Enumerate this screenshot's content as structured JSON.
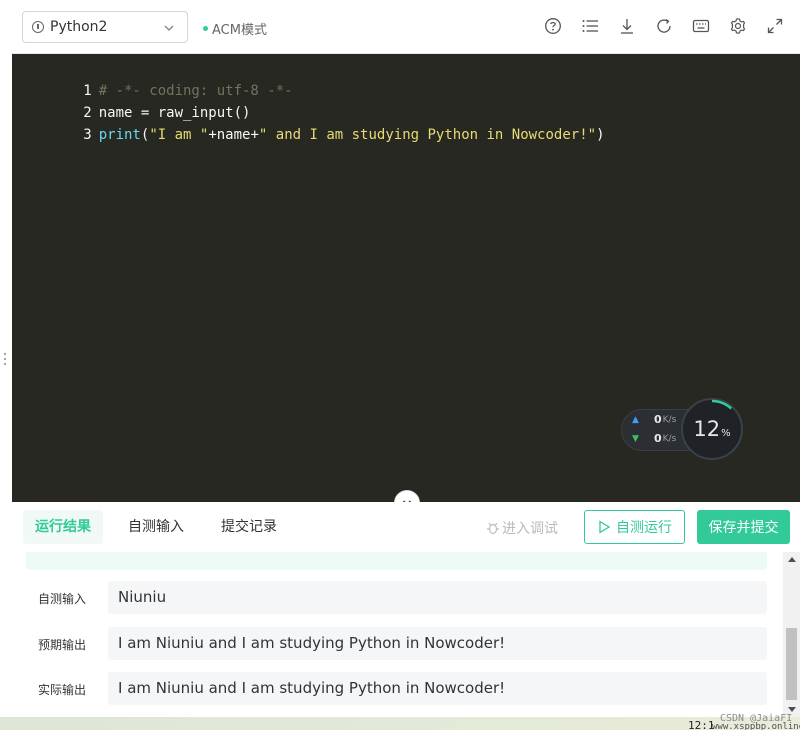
{
  "toolbar": {
    "language": "Python2",
    "mode_label": "ACM模式",
    "icons": [
      "help-icon",
      "list-icon",
      "download-icon",
      "refresh-icon",
      "keyboard-icon",
      "gear-icon",
      "expand-icon"
    ]
  },
  "editor": {
    "lines": [
      {
        "num": "1",
        "text": "# -*- coding: utf-8 -*-"
      },
      {
        "num": "2",
        "text": "name = raw_input()"
      },
      {
        "num": "3",
        "func": "print",
        "open": "(",
        "str1": "\"I am \"",
        "mid": "+name+",
        "str2": "\" and I am studying Python in Nowcoder!\"",
        "close": ")"
      }
    ]
  },
  "net_widget": {
    "upload": "0",
    "download": "0",
    "unit": "K/s",
    "cpu": "12",
    "cpu_unit": "%"
  },
  "panel": {
    "tabs": [
      "运行结果",
      "自测输入",
      "提交记录"
    ],
    "debug_label": "进入调试",
    "run_label": "自测运行",
    "submit_label": "保存并提交"
  },
  "results": [
    {
      "label": "自测输入",
      "value": "Niuniu"
    },
    {
      "label": "预期输出",
      "value": "I am Niuniu and I am studying Python in Nowcoder!"
    },
    {
      "label": "实际输出",
      "value": "I am Niuniu and I am studying Python in Nowcoder!"
    }
  ],
  "footer": {
    "clock": "12:1",
    "watermark": "CSDN @JaiaFI",
    "watermark2": "www.xsppbp.online"
  },
  "colors": {
    "accent": "#32ca99",
    "editor_bg": "#272822"
  }
}
